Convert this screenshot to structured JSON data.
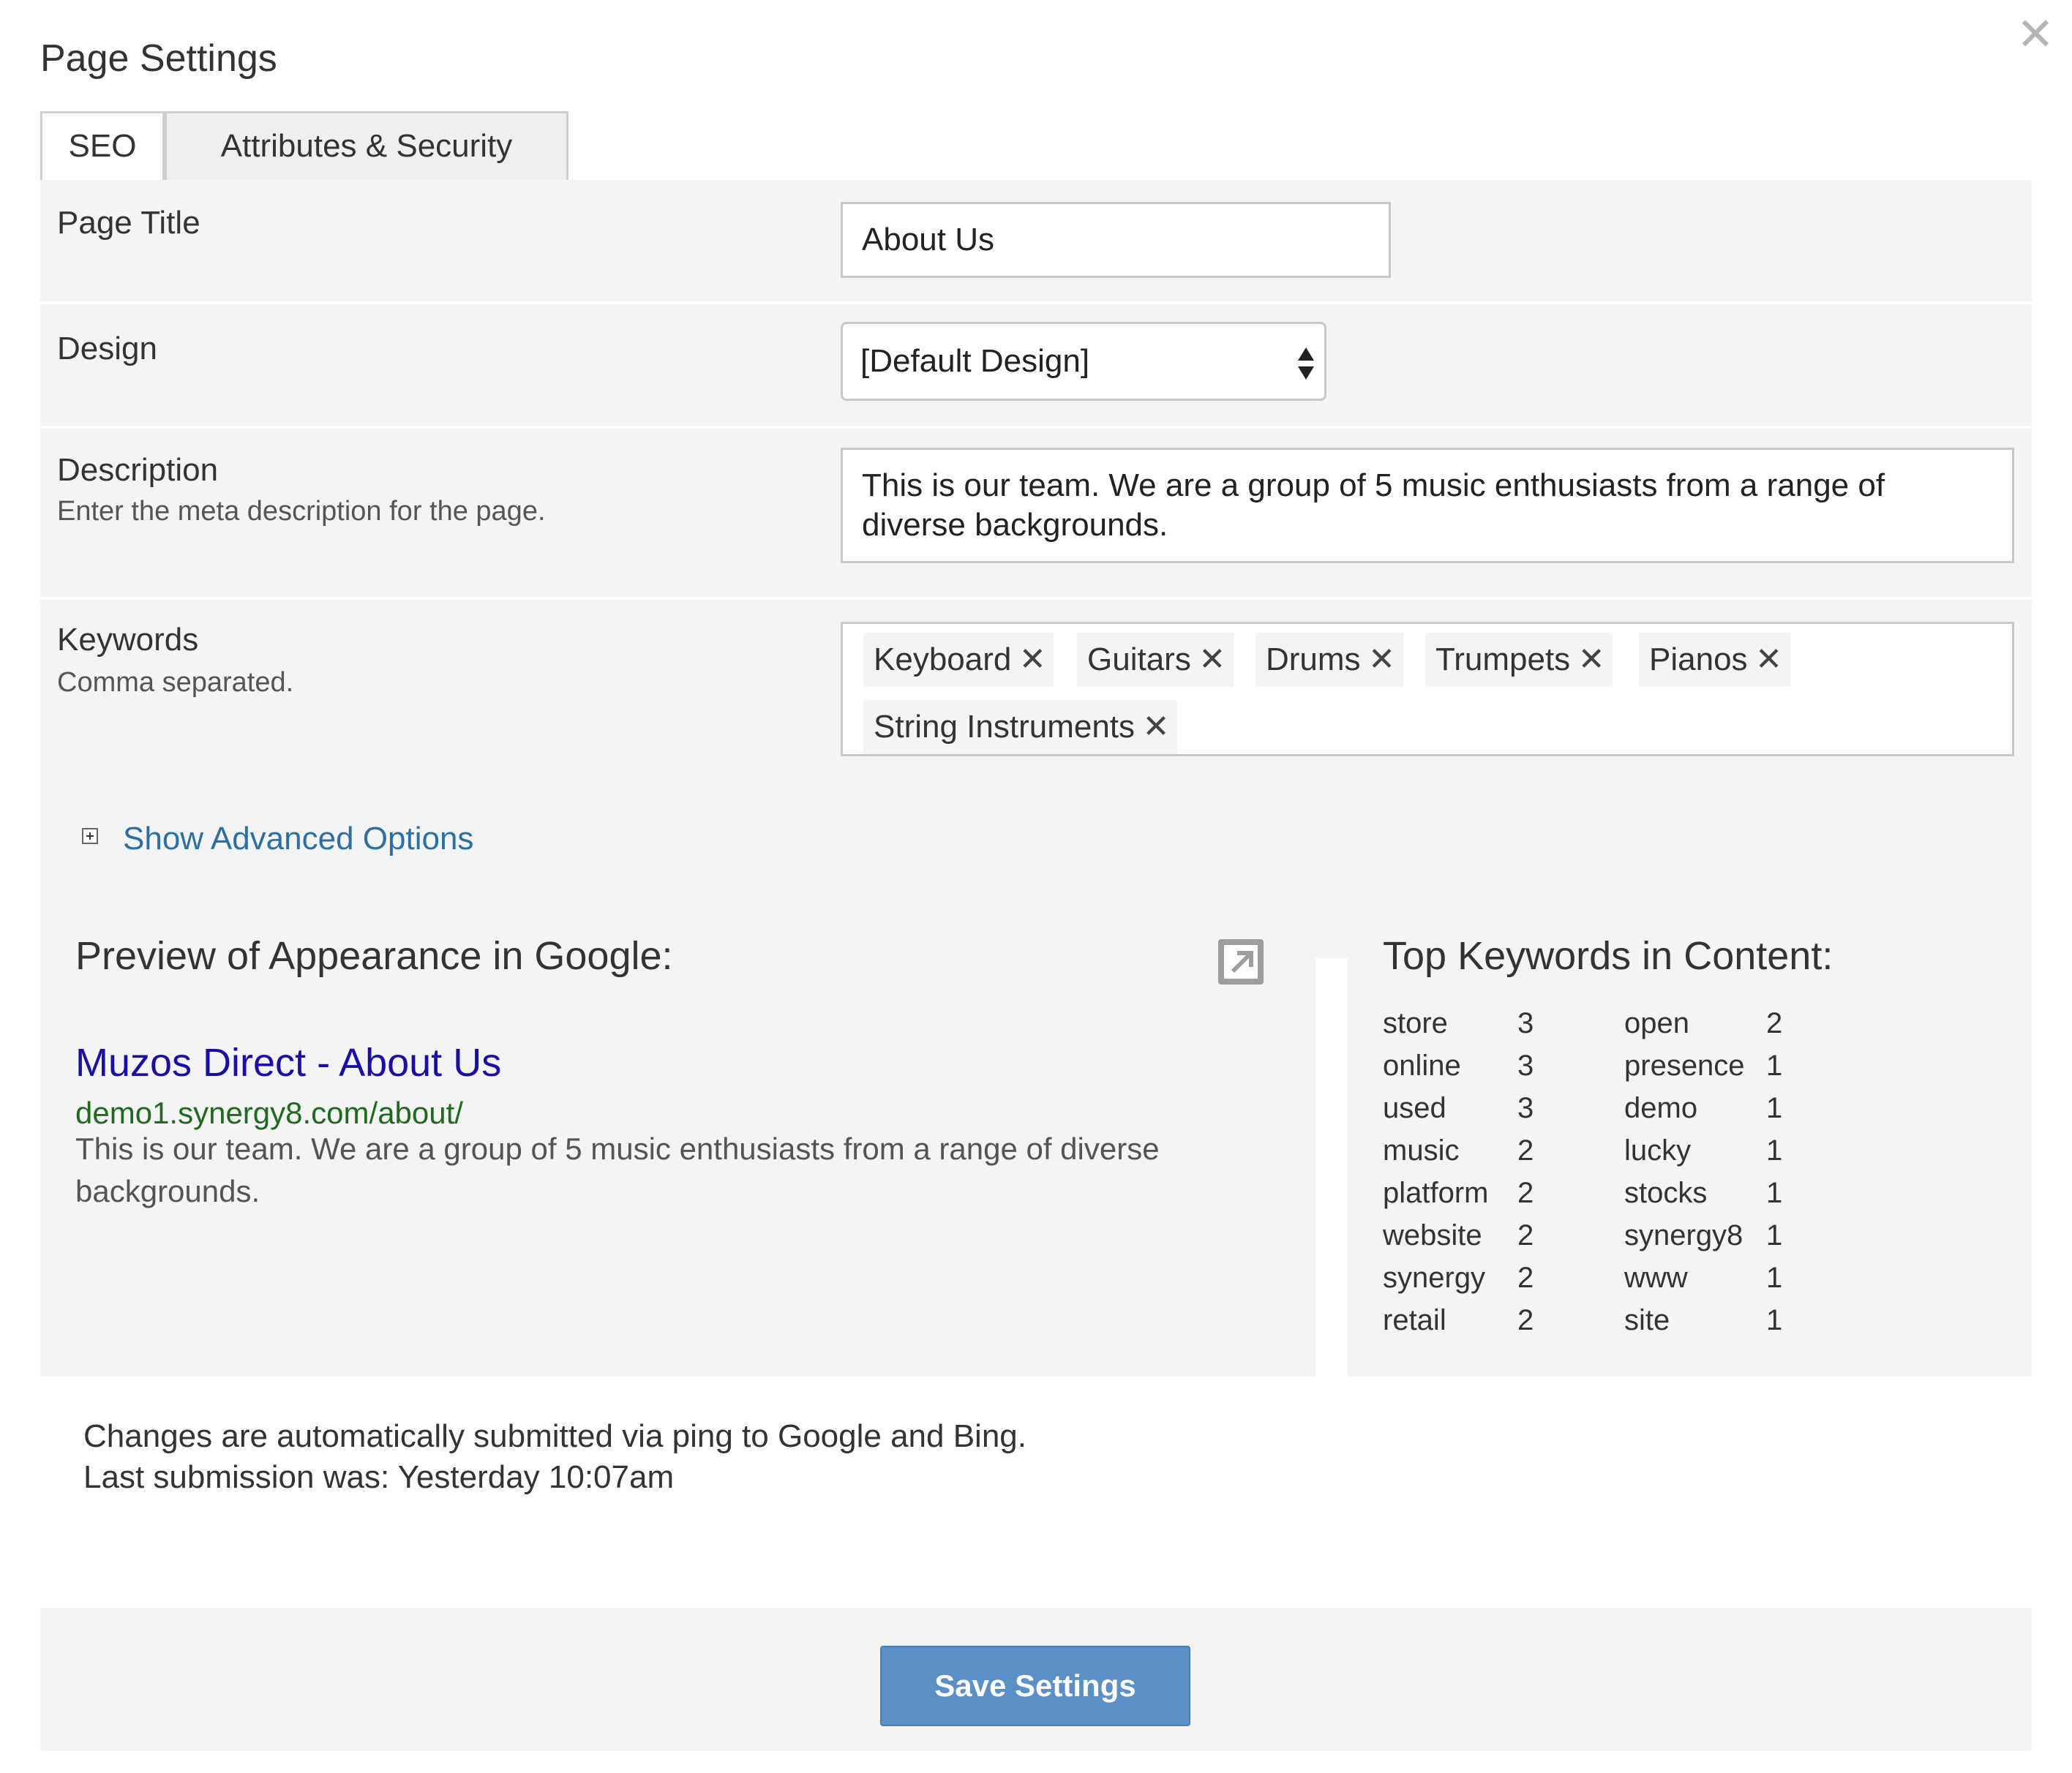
{
  "dialog": {
    "title": "Page Settings"
  },
  "tabs": [
    {
      "label": "SEO",
      "active": true
    },
    {
      "label": "Attributes & Security",
      "active": false
    }
  ],
  "form": {
    "page_title": {
      "label": "Page Title",
      "value": "About Us"
    },
    "design": {
      "label": "Design",
      "selected": "[Default Design]"
    },
    "description": {
      "label": "Description",
      "help": "Enter the meta description for the page.",
      "value": "This is our team. We are a group of 5 music enthusiasts from a range of diverse backgrounds."
    },
    "keywords": {
      "label": "Keywords",
      "help": "Comma separated.",
      "tags": [
        "Keyboard",
        "Guitars",
        "Drums",
        "Trumpets",
        "Pianos",
        "String Instruments"
      ]
    }
  },
  "advanced": {
    "label": "Show Advanced Options"
  },
  "preview": {
    "heading": "Preview of Appearance in Google:",
    "result_title": "Muzos Direct - About Us",
    "result_url": "demo1.synergy8.com/about/",
    "result_desc": "This is our team. We are a group of 5 music enthusiasts from a range of diverse backgrounds."
  },
  "top_keywords": {
    "heading": "Top Keywords in Content:",
    "items": [
      {
        "word": "store",
        "count": "3"
      },
      {
        "word": "online",
        "count": "3"
      },
      {
        "word": "used",
        "count": "3"
      },
      {
        "word": "music",
        "count": "2"
      },
      {
        "word": "platform",
        "count": "2"
      },
      {
        "word": "website",
        "count": "2"
      },
      {
        "word": "synergy",
        "count": "2"
      },
      {
        "word": "retail",
        "count": "2"
      },
      {
        "word": "open",
        "count": "2"
      },
      {
        "word": "presence",
        "count": "1"
      },
      {
        "word": "demo",
        "count": "1"
      },
      {
        "word": "lucky",
        "count": "1"
      },
      {
        "word": "stocks",
        "count": "1"
      },
      {
        "word": "synergy8",
        "count": "1"
      },
      {
        "word": "www",
        "count": "1"
      },
      {
        "word": "site",
        "count": "1"
      }
    ]
  },
  "ping": {
    "line1": "Changes are automatically submitted via ping to Google and Bing.",
    "line2": "Last submission was: Yesterday 10:07am"
  },
  "footer": {
    "save_label": "Save Settings"
  },
  "colors": {
    "link": "#1a0dab",
    "url": "#1e6b1e",
    "accent_link": "#2a6fa8",
    "button": "#5b8fc7"
  }
}
